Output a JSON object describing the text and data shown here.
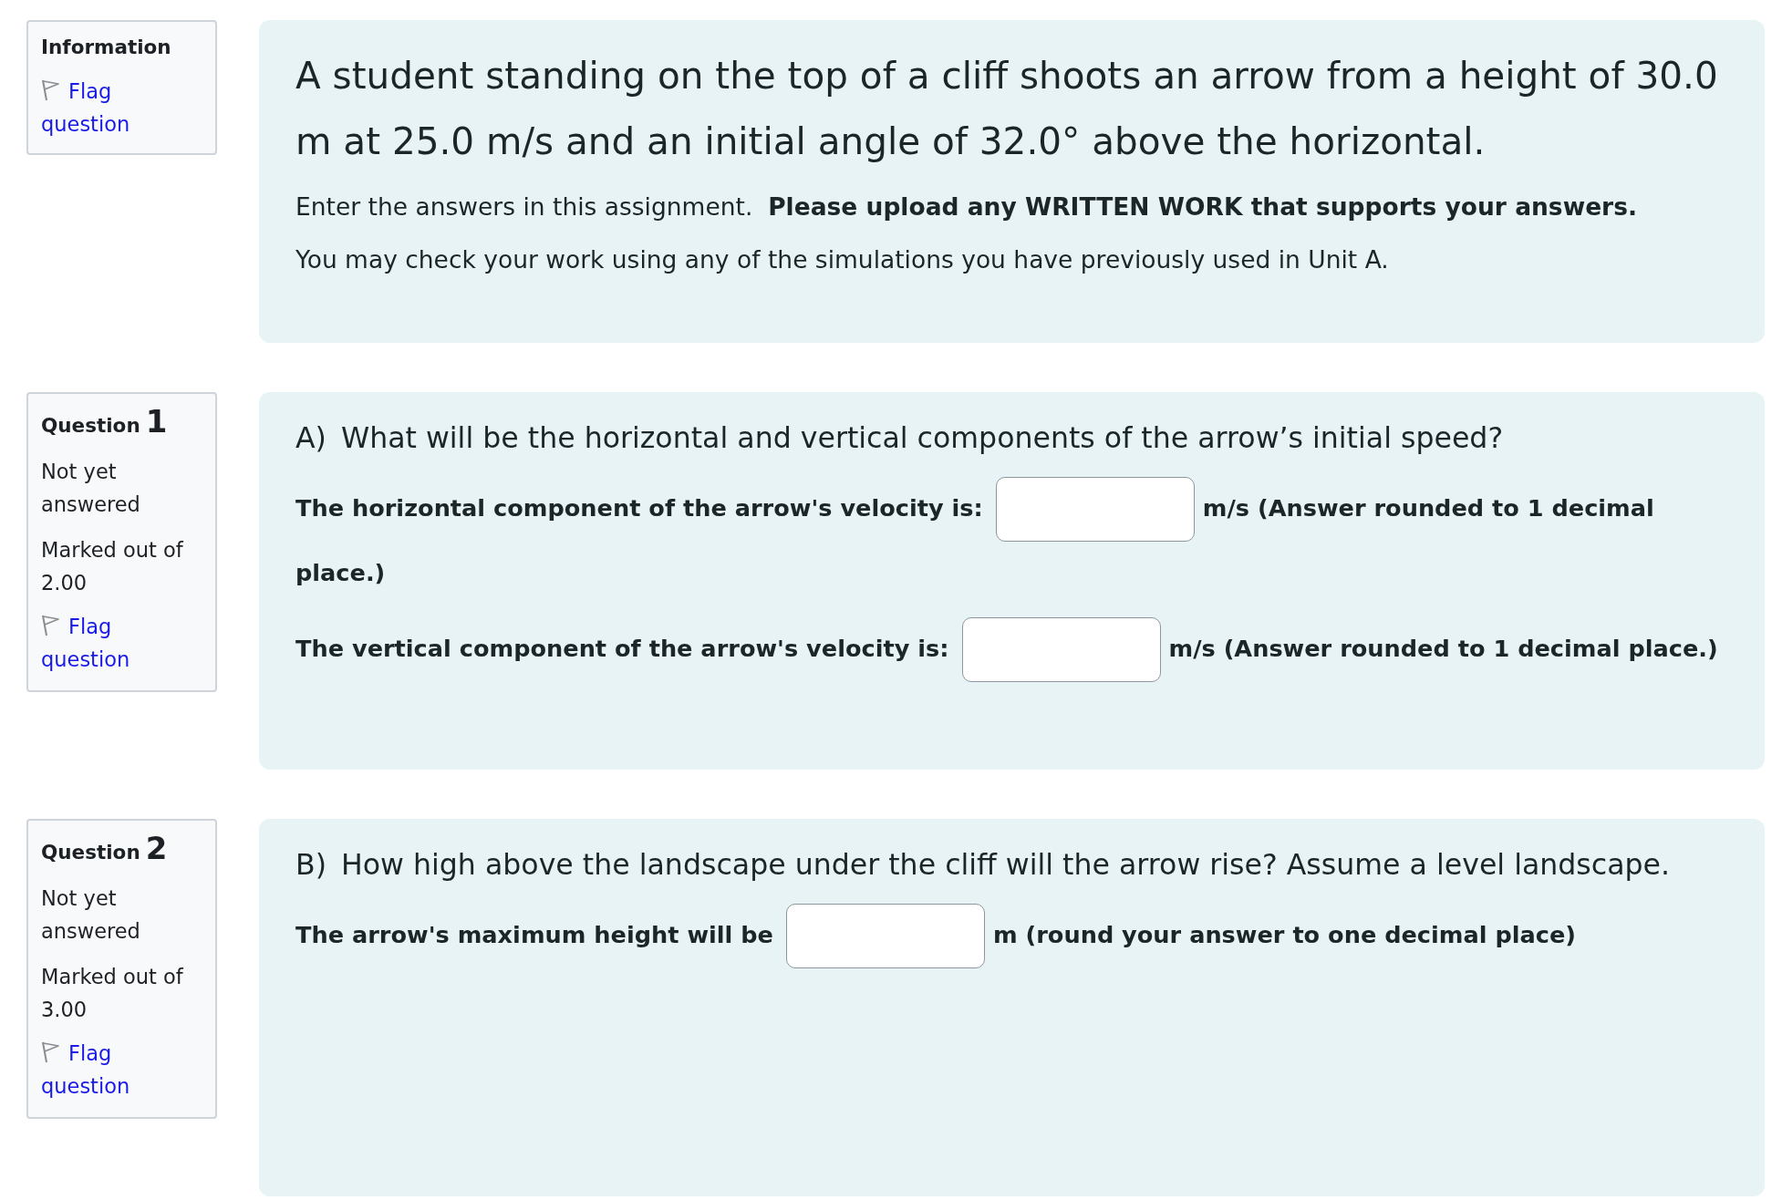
{
  "questions": [
    {
      "kind": "info",
      "info": {
        "heading": "Information",
        "flag": {
          "label": "Flag question",
          "flagged": false
        }
      },
      "content": {
        "statement": "A student standing on the top of a cliff shoots an arrow from a height of 30.0 m at 25.0 m/s and an initial angle of 32.0° above the horizontal.",
        "notes": [
          "Enter the answers in this assignment.  **Please upload any WRITTEN WORK that supports your answers.**",
          "You may check your work using any of the simulations you have previously used in Unit A."
        ]
      }
    },
    {
      "kind": "question",
      "info": {
        "heading": "Question",
        "number": "1",
        "state": "Not yet answered",
        "grade": "Marked out of 2.00",
        "flag": {
          "label": "Flag question",
          "flagged": false
        }
      },
      "content": {
        "part": "A)",
        "prompt": "What will be the horizontal and vertical components of the arrow’s initial speed?",
        "answers": [
          {
            "label": "The horizontal component of the arrow's velocity is:",
            "unit": "m/s (Answer rounded to 1 decimal place.)"
          },
          {
            "label": "The vertical component of the arrow's velocity is:",
            "unit": "m/s (Answer rounded to 1 decimal place.)"
          }
        ]
      }
    },
    {
      "kind": "question",
      "info": {
        "heading": "Question",
        "number": "2",
        "state": "Not yet answered",
        "grade": "Marked out of 3.00",
        "flag": {
          "label": "Flag question",
          "flagged": false
        }
      },
      "content": {
        "part": "B)",
        "prompt": "How high above the landscape under the cliff will the arrow rise? Assume a level landscape.",
        "answers": [
          {
            "label": "The arrow's maximum height will be",
            "unit": "m (round your answer to one decimal place)"
          }
        ]
      }
    }
  ]
}
